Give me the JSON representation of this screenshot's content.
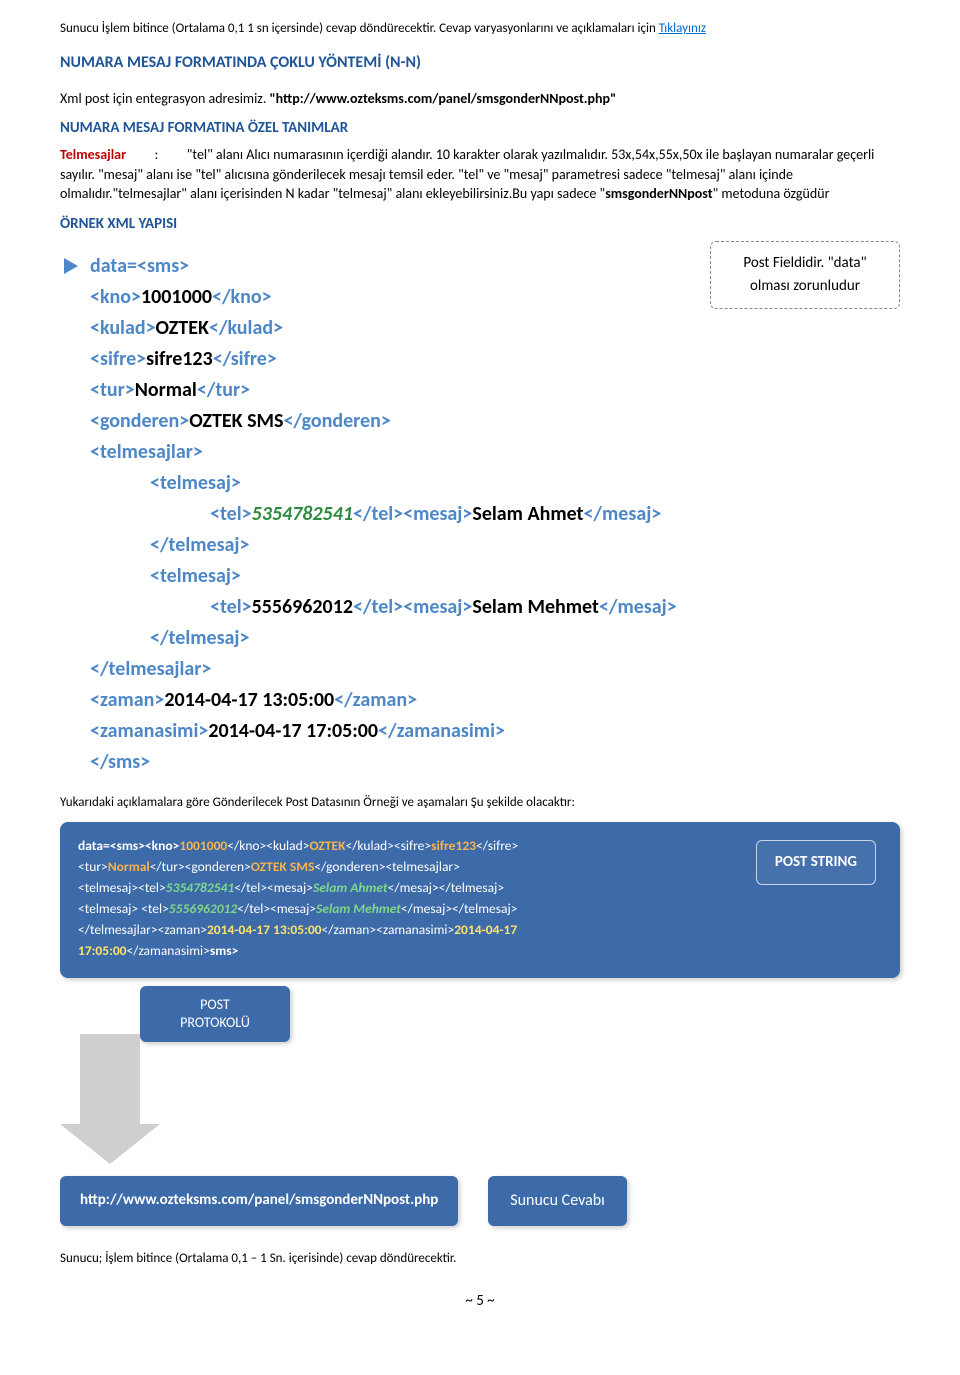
{
  "intro": {
    "prefix": "Sunucu İşlem bitince (Ortalama 0,1 1  sn içersinde)  cevap döndürecektir. Cevap varyasyonlarını ve açıklamaları için ",
    "link": "Tıklayınız"
  },
  "heading_format": "NUMARA MESAJ FORMATINDA  ÇOKLU YÖNTEMİ (N-N)",
  "integration_line": "Xml post için entegrasyon adresimiz. ",
  "integration_url": "\"http://www.ozteksms.com/panel/smsgonderNNpost.php\"",
  "heading_defs": "NUMARA MESAJ FORMATINA ÖZEL TANIMLAR",
  "def_label": "Telmesajlar",
  "def_sep": ":",
  "def_text": "\"tel\" alanı Alıcı numarasının içerdiği alandır. 10 karakter olarak yazılmalıdır. 53x,54x,55x,50x ile başlayan numaralar geçerli sayılır. \"mesaj\"  alanı ise \"tel\" alıcısına gönderilecek mesajı temsil eder. \"tel\" ve \"mesaj\" parametresi sadece \"telmesaj\" alanı içinde olmalıdır.\"telmesajlar\" alanı içerisinden N kadar \"telmesaj\" alanı ekleyebilirsiniz.Bu yapı sadece \"",
  "def_bold": "smsgonderNNpost",
  "def_tail": "\" metoduna özgüdür",
  "example_heading": "ÖRNEK XML YAPISI",
  "callout": {
    "line1": "Post Fieldidir. \"data\"",
    "line2": "olması zorunludur"
  },
  "xml": {
    "data_open": "data=<sms>",
    "kno_open": "<kno>",
    "kno_val": "1001000",
    "kno_close": "</kno>",
    "kulad_open": "<kulad>",
    "kulad_val": "OZTEK",
    "kulad_close": "</kulad>",
    "sifre_open": "<sifre>",
    "sifre_val": "sifre123",
    "sifre_close": "</sifre>",
    "tur_open": "<tur>",
    "tur_val": "Normal",
    "tur_close": "</tur>",
    "gonderen_open": "<gonderen>",
    "gonderen_val": "OZTEK SMS",
    "gonderen_close": "</gonderen>",
    "telmesajlar_open": "<telmesajlar>",
    "telmesaj_open": "<telmesaj>",
    "tel_open": "<tel>",
    "tel1": "5354782541",
    "tel_close": "</tel>",
    "mesaj_open": "<mesaj>",
    "mesaj1": "Selam Ahmet",
    "mesaj_close": "</mesaj>",
    "telmesaj_close": "</telmesaj>",
    "tel2": "5556962012",
    "mesaj2": "Selam Mehmet",
    "telmesajlar_close": "</telmesajlar>",
    "zaman_open": "<zaman>",
    "zaman_val": "2014-04-17 13:05:00",
    "zaman_close": "</zaman>",
    "zamanasimi_open": "<zamanasimi>",
    "zamanasimi_val": "2014-04-17 17:05:00",
    "zamanasimi_close": "</zamanasimi>",
    "sms_close": "</sms>"
  },
  "note": "Yukarıdaki açıklamalara göre Gönderilecek Post Datasının Örneği ve aşamaları Şu şekilde olacaktır:",
  "postbox": {
    "l1a": "data=<sms><kno>",
    "l1_kno": "1001000",
    "l1b": "</kno><kulad>",
    "l1_kulad": "OZTEK",
    "l1c": "</kulad><sifre>",
    "l1_sifre": "sifre123",
    "l1d": "</sifre>",
    "l2a": "<tur>",
    "l2_tur": "Normal",
    "l2b": "</tur><gonderen>",
    "l2_gon": "OZTEK SMS",
    "l2c": "</gonderen><telmesajlar>",
    "l3a": "<telmesaj><tel>",
    "l3_tel": "5354782541",
    "l3b": "</tel><mesaj>",
    "l3_msg": "Selam Ahmet",
    "l3c": "</mesaj></telmesaj>",
    "l4a": "<telmesaj> <tel>",
    "l4_tel": "5556962012",
    "l4b": "</tel><mesaj>",
    "l4_msg": "Selam Mehmet",
    "l4c": "</mesaj></telmesaj>",
    "l5a": "</telmesajlar><zaman>",
    "l5_z": "2014-04-17 13:05:00",
    "l5b": "</zaman><zamanasimi>",
    "l5_za1": "2014-04-17",
    "l6_za2": "17:05:00",
    "l6b": "</zamanasimi>",
    "l6c": "sms>"
  },
  "post_string_label": "POST STRING",
  "post_proto": {
    "l1": "POST",
    "l2": "PROTOKOLÜ"
  },
  "bottom_url": "http://www.ozteksms.com/panel/smsgonderNNpost.php",
  "reply": "Sunucu   Cevabı",
  "footer": "Sunucu; İşlem bitince (Ortalama 0,1 – 1 Sn. içerisinde)  cevap döndürecektir.",
  "page": "~ 5 ~"
}
